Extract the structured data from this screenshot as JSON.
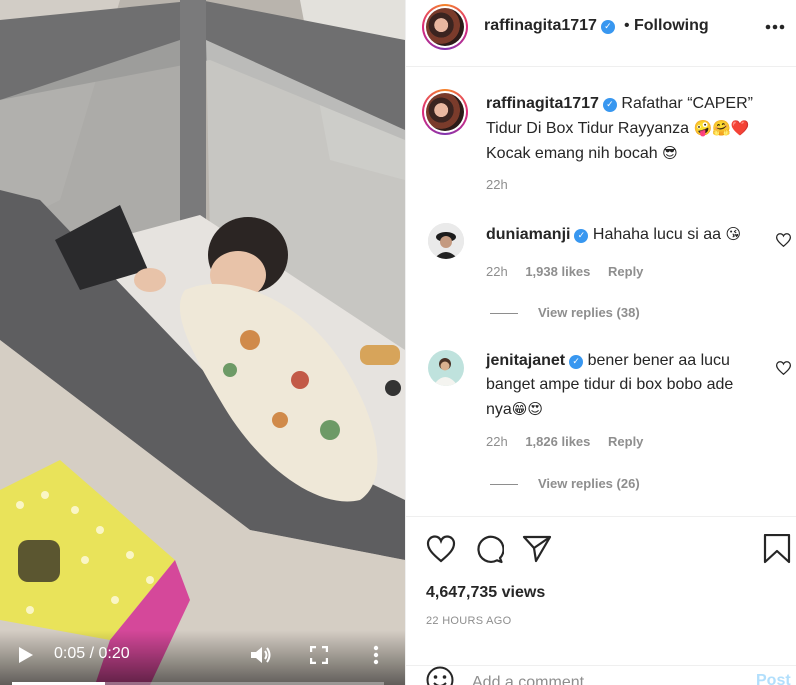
{
  "post": {
    "username": "raffinagita1717",
    "follow_status": "Following",
    "caption_line1": "Rafathar “CAPER”",
    "caption_line2": "Tidur Di Box Tidur Rayyanza",
    "caption_emojis_1": "🤪🤗❤️",
    "caption_line3": "Kocak emang nih bocah",
    "caption_emojis_2": "😎",
    "caption_time": "22h"
  },
  "video": {
    "current_time": "0:05",
    "separator": "/",
    "duration": "0:20",
    "progress_fraction": 0.25
  },
  "comments": [
    {
      "username": "duniamanji",
      "text": "Hahaha lucu si aa",
      "emojis": "😘",
      "time": "22h",
      "likes": "1,938 likes",
      "reply_label": "Reply",
      "view_replies": "View replies (38)"
    },
    {
      "username": "jenitajanet",
      "text_line1": "bener bener aa lucu",
      "text_line2": "banget ampe tidur di box bobo ade",
      "text_line3": "nya",
      "emojis": "😁😍",
      "time": "22h",
      "likes": "1,826 likes",
      "reply_label": "Reply",
      "view_replies": "View replies (26)"
    }
  ],
  "stats": {
    "views": "4,647,735 views",
    "time_ago": "22 HOURS AGO"
  },
  "composer": {
    "placeholder": "Add a comment…",
    "post_label": "Post"
  },
  "icons": {
    "verified": "verified-badge-icon",
    "like": "heart-icon",
    "comment": "comment-bubble-icon",
    "share": "paper-plane-icon",
    "save": "bookmark-icon",
    "emoji": "smiley-icon",
    "play": "play-icon",
    "volume": "volume-icon",
    "fullscreen": "fullscreen-icon",
    "options": "more-options-icon"
  },
  "colors": {
    "verified_blue": "#3897f0",
    "muted_text": "#8e8e8e",
    "post_button_disabled": "#b2dffc",
    "border": "#efefef"
  }
}
